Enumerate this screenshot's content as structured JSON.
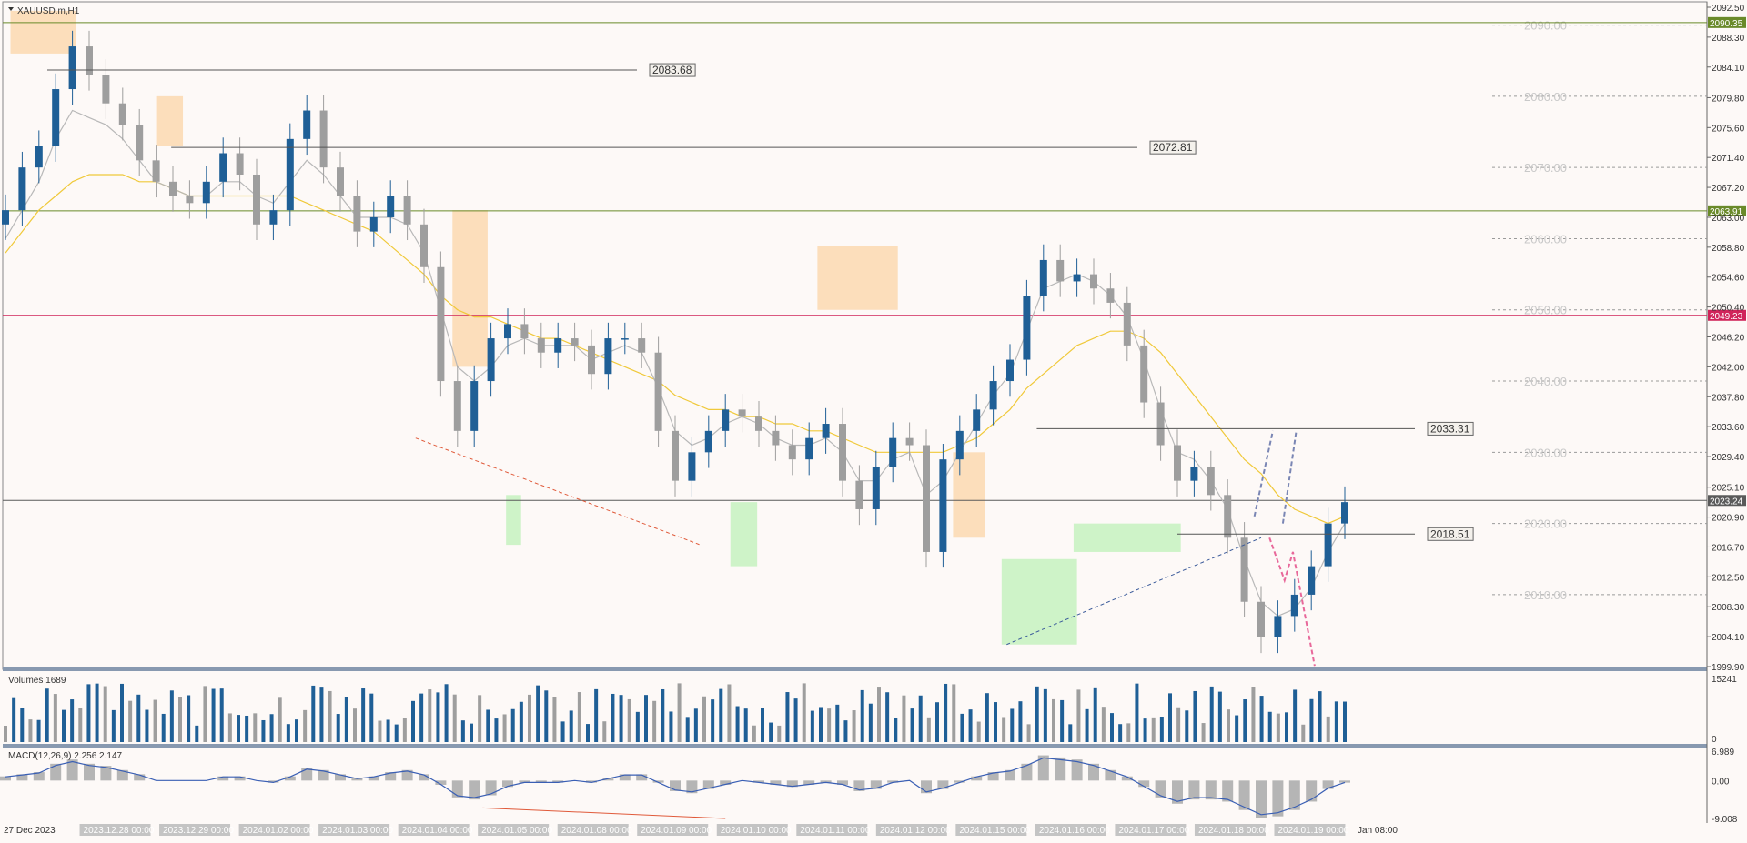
{
  "window": {
    "title": "XAUUSD.m,H1"
  },
  "chart_data": [
    {
      "type": "line",
      "name": "price",
      "ylim": [
        1999.9,
        2092.5
      ],
      "y_ticks": [
        "2092.50",
        "2088.30",
        "2084.10",
        "2079.80",
        "2075.60",
        "2071.40",
        "2067.20",
        "2063.00",
        "2058.80",
        "2054.60",
        "2050.40",
        "2046.20",
        "2042.00",
        "2037.80",
        "2033.60",
        "2029.40",
        "2025.10",
        "2020.90",
        "2016.70",
        "2012.50",
        "2008.30",
        "2004.10",
        "1999.90"
      ],
      "watermark_levels": [
        "2090.00",
        "2080.00",
        "2070.00",
        "2060.00",
        "2050.00",
        "2040.00",
        "2030.00",
        "2020.00",
        "2010.00"
      ],
      "hlines": [
        {
          "value": 2090.35,
          "label": "2090.35",
          "color": "#6a8a2a"
        },
        {
          "value": 2063.91,
          "label": "2063.91",
          "color": "#6a8a2a"
        },
        {
          "value": 2049.23,
          "label": "2049.23",
          "color": "#d0245a"
        },
        {
          "value": 2023.24,
          "label": "2023.24",
          "color": "#5a5a5a"
        }
      ],
      "annotations": [
        "2083.68",
        "2072.81",
        "2033.31",
        "2018.51"
      ],
      "x": [
        0,
        1,
        2,
        3,
        4,
        5,
        6,
        7,
        8,
        9,
        10,
        11,
        12,
        13,
        14,
        15,
        16,
        17,
        18,
        19,
        20,
        21,
        22,
        23,
        24,
        25,
        26,
        27,
        28,
        29,
        30,
        31,
        32,
        33,
        34,
        35,
        36,
        37,
        38,
        39,
        40,
        41,
        42,
        43,
        44,
        45,
        46,
        47,
        48,
        49,
        50,
        51,
        52,
        53,
        54,
        55,
        56,
        57,
        58,
        59,
        60,
        61,
        62,
        63,
        64,
        65,
        66,
        67,
        68,
        69,
        70,
        71,
        72,
        73,
        74,
        75,
        76,
        77,
        78,
        79,
        80
      ],
      "close": [
        2064,
        2070,
        2073,
        2081,
        2087,
        2083,
        2079,
        2076,
        2071,
        2068,
        2066,
        2065,
        2068,
        2072,
        2069,
        2062,
        2064,
        2074,
        2078,
        2070,
        2066,
        2061,
        2063,
        2066,
        2062,
        2056,
        2040,
        2033,
        2040,
        2046,
        2048,
        2046,
        2044,
        2046,
        2045,
        2041,
        2046,
        2046,
        2044,
        2033,
        2026,
        2030,
        2033,
        2036,
        2035,
        2033,
        2031,
        2029,
        2032,
        2034,
        2026,
        2022,
        2028,
        2032,
        2031,
        2016,
        2029,
        2033,
        2036,
        2040,
        2043,
        2052,
        2057,
        2054,
        2055,
        2053,
        2051,
        2045,
        2037,
        2031,
        2026,
        2028,
        2024,
        2018,
        2009,
        2004,
        2007,
        2010,
        2014,
        2020,
        2023
      ],
      "ma_slow": [
        2058,
        2061,
        2064,
        2066,
        2068,
        2069,
        2069,
        2069,
        2068,
        2068,
        2067,
        2066,
        2066,
        2066,
        2066,
        2066,
        2066,
        2066,
        2065,
        2064,
        2063,
        2062,
        2061,
        2059,
        2057,
        2055,
        2052,
        2050,
        2049,
        2049,
        2048,
        2047,
        2046,
        2046,
        2045,
        2044,
        2043,
        2042,
        2041,
        2040,
        2038,
        2037,
        2036,
        2036,
        2035,
        2035,
        2034,
        2034,
        2033,
        2033,
        2032,
        2031,
        2030,
        2030,
        2030,
        2030,
        2030,
        2031,
        2032,
        2034,
        2036,
        2039,
        2041,
        2043,
        2045,
        2046,
        2047,
        2047,
        2046,
        2044,
        2041,
        2038,
        2035,
        2032,
        2029,
        2027,
        2024,
        2022,
        2021,
        2020,
        2021
      ],
      "ma_fast": [
        2060,
        2064,
        2068,
        2074,
        2078,
        2077,
        2076,
        2074,
        2071,
        2068,
        2067,
        2066,
        2066,
        2068,
        2068,
        2066,
        2065,
        2068,
        2071,
        2069,
        2066,
        2063,
        2063,
        2063,
        2062,
        2058,
        2050,
        2042,
        2040,
        2042,
        2045,
        2046,
        2045,
        2045,
        2045,
        2043,
        2044,
        2045,
        2044,
        2039,
        2033,
        2031,
        2032,
        2034,
        2035,
        2034,
        2032,
        2031,
        2031,
        2032,
        2030,
        2026,
        2026,
        2029,
        2030,
        2024,
        2026,
        2030,
        2034,
        2038,
        2041,
        2047,
        2053,
        2054,
        2055,
        2054,
        2052,
        2049,
        2043,
        2036,
        2030,
        2029,
        2026,
        2022,
        2015,
        2009,
        2007,
        2008,
        2011,
        2016,
        2020
      ]
    },
    {
      "type": "bar",
      "name": "Volumes 1689",
      "title": "Volumes 1689",
      "ylim": [
        0,
        15241
      ],
      "y_ticks": [
        "15241",
        "0"
      ]
    },
    {
      "type": "area",
      "name": "MACD(12,26,9) 2.256 2.147",
      "title": "MACD(12,26,9) 2.256 2.147",
      "ylim": [
        -9.008,
        6.989
      ],
      "y_ticks": [
        "6.989",
        "0.00",
        "-9.008"
      ]
    }
  ],
  "x_axis_labels": [
    {
      "text": "27 Dec 2023",
      "box": false
    },
    {
      "text": "2023.12.28 00:00",
      "box": true
    },
    {
      "text": "2023.12.29 00:00",
      "box": true
    },
    {
      "text": "2024.01.02 00:00",
      "box": true
    },
    {
      "text": "2024.01.03 00:00",
      "box": true
    },
    {
      "text": "2024.01.04 00:00",
      "box": true
    },
    {
      "text": "2024.01.05 00:00",
      "box": true
    },
    {
      "text": "2024.01.08 00:00",
      "box": true
    },
    {
      "text": "2024.01.09 00:00",
      "box": true
    },
    {
      "text": "2024.01.10 00:00",
      "box": true
    },
    {
      "text": "2024.01.11 00:00",
      "box": true
    },
    {
      "text": "2024.01.12 00:00",
      "box": true
    },
    {
      "text": "2024.01.15 00:00",
      "box": true
    },
    {
      "text": "2024.01.16 00:00",
      "box": true
    },
    {
      "text": "2024.01.17 00:00",
      "box": true
    },
    {
      "text": "2024.01.18 00:00",
      "box": true
    },
    {
      "text": "2024.01.19 00:00",
      "box": true
    },
    {
      "text": "Jan 08:00",
      "box": false
    }
  ],
  "colors": {
    "bull": "#1f5f96",
    "bear": "#9e9e9e",
    "ma_slow": "#f0c93a",
    "ma_fast": "#b8b8b8",
    "supply_zone": "#fbd9b0",
    "demand_zone": "#c5f2c0",
    "bg": "#fdf9f7"
  }
}
